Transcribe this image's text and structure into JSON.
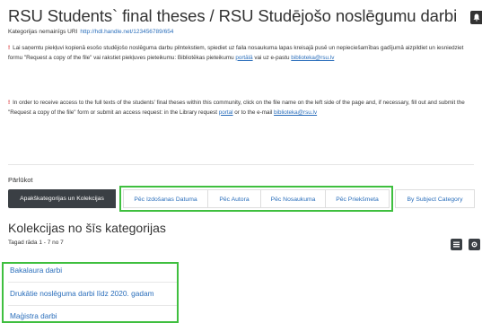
{
  "header": {
    "title": "RSU Students` final theses / RSU Studējošo noslēgumu darbi",
    "uri_label": "Kategorijas nemainīgs URI",
    "uri_value": "http://hdl.handle.net/123456789/654"
  },
  "notice_lv": {
    "mark": "!",
    "text": "Lai saņemtu piekļuvi kopienā esošo studējošo noslēguma darbu pilntekstiem, spiediet uz faila nosaukuma lapas kreisajā pusē un nepieciešamības gadījumā aizpildiet un iesniedziet formu \"Request a copy of the file\" vai rakstiet piekļuves pieteikumu: Bibliotēkas pieteikumu ",
    "link_portal": "portālā",
    "text_mid": " vai uz e-pastu ",
    "link_email": "biblioteka@rsu.lv"
  },
  "notice_en": {
    "mark": "!",
    "text": "In order to receive access to the full texts of the students' final theses within this community, click on the file name on the left side of the page and, if necessary, fill out and submit the \"Request a copy of the file\" form or submit an access request: in the Library request ",
    "link_portal": "portal",
    "text_mid": " or to the e-mail ",
    "link_email": "biblioteka@rsu.lv"
  },
  "browse": {
    "label": "Pārlūkot",
    "buttons": {
      "subcategories": "Apakškategorijas un Kolekcijas",
      "by_date": "Pēc Izdošanas Datuma",
      "by_author": "Pēc Autora",
      "by_title": "Pēc Nosaukuma",
      "by_subject": "Pēc Priekšmeta",
      "by_subject_category": "By Subject Category"
    }
  },
  "collections": {
    "heading": "Kolekcijas no šīs kategorijas",
    "showing": "Tagad rāda 1 - 7 no 7",
    "items": [
      "Bakalaura darbi",
      "Drukātie noslēguma darbi līdz 2020. gadam",
      "Maģistra darbi"
    ]
  },
  "icons": [
    "bell-icon",
    "list-view-icon",
    "settings-icon"
  ],
  "colors": {
    "highlight": "#3fbf3f",
    "link": "#2a6ebb",
    "dark_button": "#3a3f44",
    "alert": "#d9262a"
  }
}
